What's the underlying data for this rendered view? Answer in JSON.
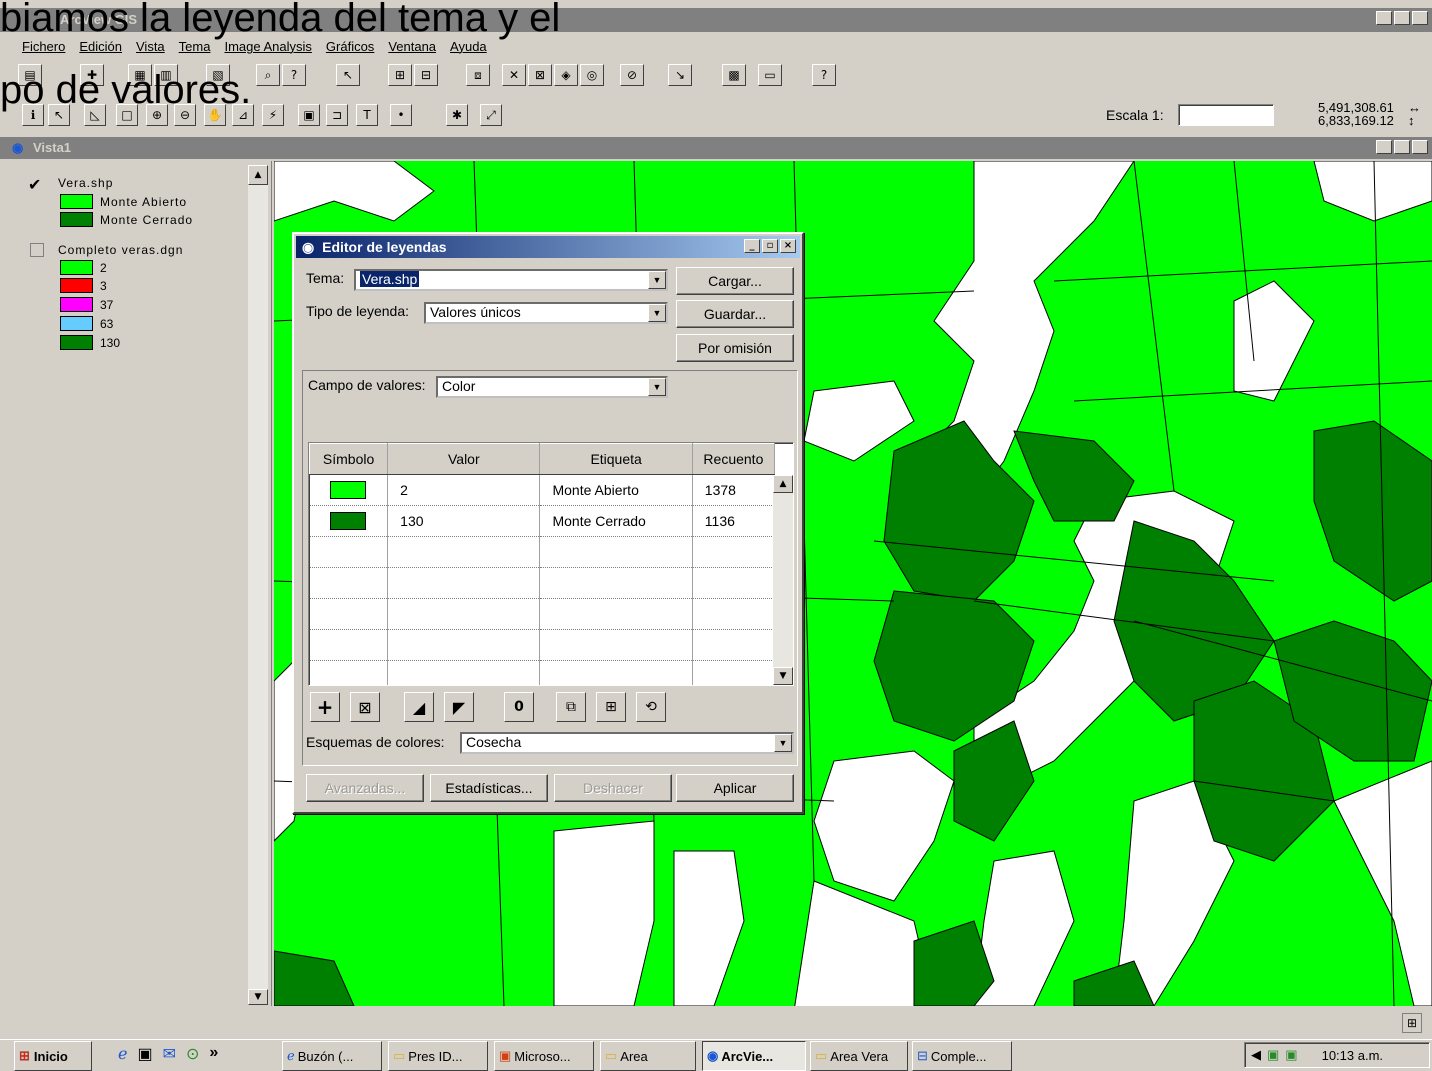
{
  "overlay_caption": {
    "line1": "biamos la leyenda del tema y el",
    "line2": "po de valores."
  },
  "app": {
    "title": "ArcView GIS",
    "window_controls": [
      "_",
      "▫",
      "×"
    ]
  },
  "menu": [
    "Fichero",
    "Edición",
    "Vista",
    "Tema",
    "Image Analysis",
    "Gráficos",
    "Ventana",
    "Ayuda"
  ],
  "scale": {
    "label": "Escala 1:",
    "value": "",
    "coord_x": "5,491,308.61",
    "coord_y": "6,833,169.12"
  },
  "view": {
    "title": "Vista1"
  },
  "toc": {
    "themes": [
      {
        "name": "Vera.shp",
        "checked": true,
        "classes": [
          {
            "label": "Monte Abierto",
            "color": "#00ff00"
          },
          {
            "label": "Monte Cerrado",
            "color": "#008000"
          }
        ]
      },
      {
        "name": "Completo veras.dgn",
        "checked": false,
        "classes": [
          {
            "label": "2",
            "color": "#00ff00"
          },
          {
            "label": "3",
            "color": "#ff0000"
          },
          {
            "label": "37",
            "color": "#ff00ff"
          },
          {
            "label": "63",
            "color": "#66ccff"
          },
          {
            "label": "130",
            "color": "#008000"
          }
        ]
      }
    ]
  },
  "legend_editor": {
    "title": "Editor de leyendas",
    "tema_label": "Tema:",
    "tema_value": "Vera.shp",
    "tipo_label": "Tipo de leyenda:",
    "tipo_value": "Valores únicos",
    "cargar": "Cargar...",
    "guardar": "Guardar...",
    "por_omision": "Por omisión",
    "campo_label": "Campo de valores:",
    "campo_value": "Color",
    "columns": [
      "Símbolo",
      "Valor",
      "Etiqueta",
      "Recuento"
    ],
    "rows": [
      {
        "color": "#00ff00",
        "valor": "2",
        "etiqueta": "Monte Abierto",
        "recuento": "1378"
      },
      {
        "color": "#008000",
        "valor": "130",
        "etiqueta": "Monte Cerrado",
        "recuento": "1136"
      }
    ],
    "esquemas_label": "Esquemas de colores:",
    "esquemas_value": "Cosecha",
    "avanzadas": "Avanzadas...",
    "estadisticas": "Estadísticas...",
    "deshacer": "Deshacer",
    "aplicar": "Aplicar"
  },
  "taskbar": {
    "start": "Inicio",
    "tasks": [
      "Buzón (...",
      "Pres ID...",
      "Microso...",
      "Area",
      "ArcVie...",
      "Area Vera",
      "Comple..."
    ],
    "clock": "10:13 a.m."
  }
}
